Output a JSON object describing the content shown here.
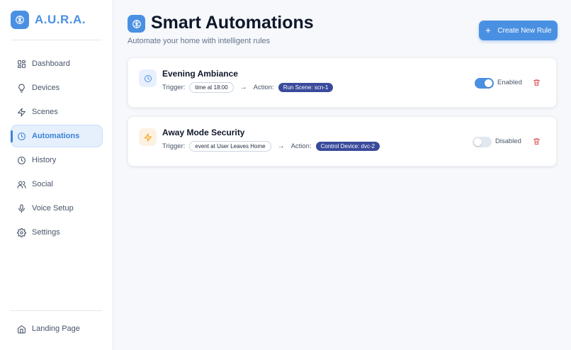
{
  "brand": {
    "name": "A.U.R.A."
  },
  "sidebar": {
    "items": [
      {
        "label": "Dashboard",
        "icon": "dashboard-icon"
      },
      {
        "label": "Devices",
        "icon": "lightbulb-icon"
      },
      {
        "label": "Scenes",
        "icon": "bolt-icon"
      },
      {
        "label": "Automations",
        "icon": "clock-icon",
        "active": true
      },
      {
        "label": "History",
        "icon": "history-clock-icon"
      },
      {
        "label": "Social",
        "icon": "users-icon"
      },
      {
        "label": "Voice Setup",
        "icon": "microphone-icon"
      },
      {
        "label": "Settings",
        "icon": "gear-icon"
      }
    ],
    "bottom": {
      "label": "Landing Page",
      "icon": "home-icon"
    }
  },
  "page": {
    "title": "Smart Automations",
    "subtitle": "Automate your home with intelligent rules",
    "create_button": "Create New Rule"
  },
  "rules": [
    {
      "name": "Evening Ambiance",
      "trigger_label": "Trigger:",
      "trigger": "time at 18:00",
      "action_label": "Action:",
      "action": "Run Scene: scn-1",
      "enabled": true,
      "status": "Enabled",
      "icon": "clock-icon"
    },
    {
      "name": "Away Mode Security",
      "trigger_label": "Trigger:",
      "trigger": "event at User Leaves Home",
      "action_label": "Action:",
      "action": "Control Device: dvc-2",
      "enabled": false,
      "status": "Disabled",
      "icon": "bolt-icon"
    }
  ],
  "colors": {
    "accent": "#4a90e2",
    "action_pill": "#3a4a9b",
    "delete": "#e05252",
    "orange_icon": "#f59e0b"
  }
}
